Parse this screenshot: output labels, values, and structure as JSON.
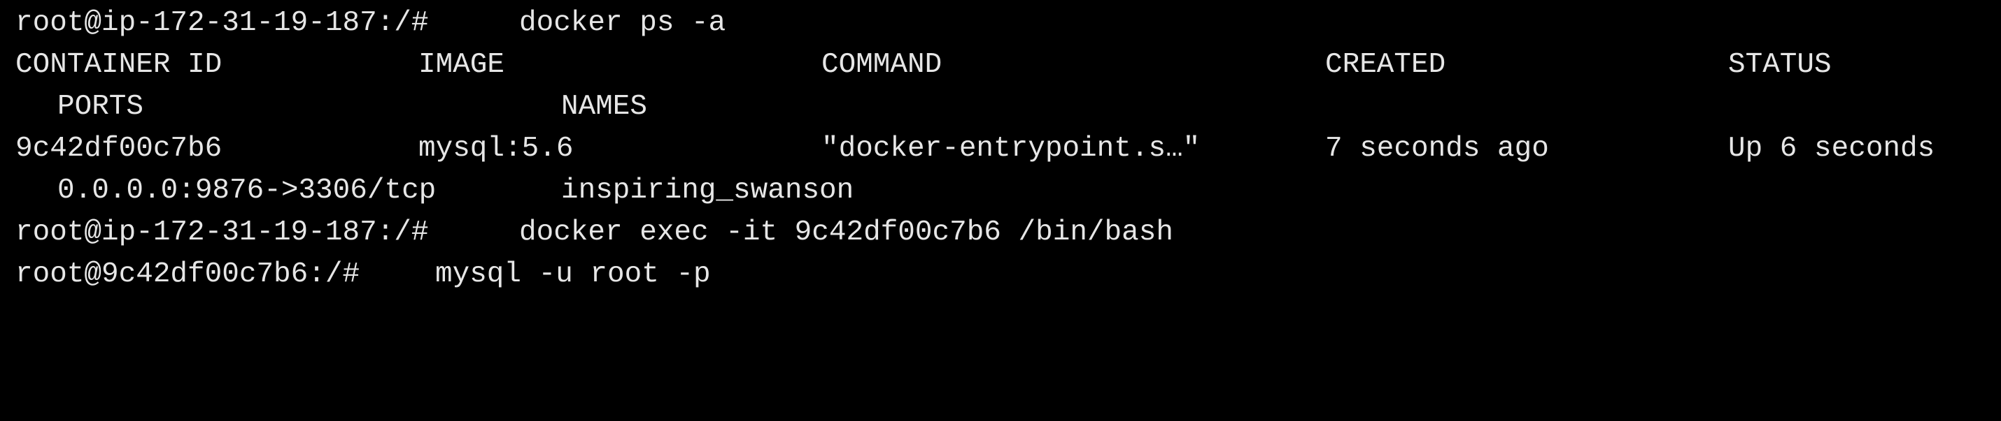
{
  "terminal": {
    "prompt1": "root@ip-172-31-19-187:/#",
    "cmd1": "docker ps -a",
    "headers": {
      "container_id": "CONTAINER ID",
      "image": "IMAGE",
      "command": "COMMAND",
      "created": "CREATED",
      "status": "STATUS",
      "ports": "PORTS",
      "names": "NAMES"
    },
    "row": {
      "container_id": "9c42df00c7b6",
      "image": "mysql:5.6",
      "command": "\"docker-entrypoint.s…\"",
      "created": "7 seconds ago",
      "status": "Up 6 seconds",
      "ports": "0.0.0.0:9876->3306/tcp",
      "names": "inspiring_swanson"
    },
    "prompt2": "root@ip-172-31-19-187:/#",
    "cmd2": "docker exec -it 9c42df00c7b6 /bin/bash",
    "prompt3": "root@9c42df00c7b6:/#",
    "cmd3": "mysql -u root -p"
  }
}
